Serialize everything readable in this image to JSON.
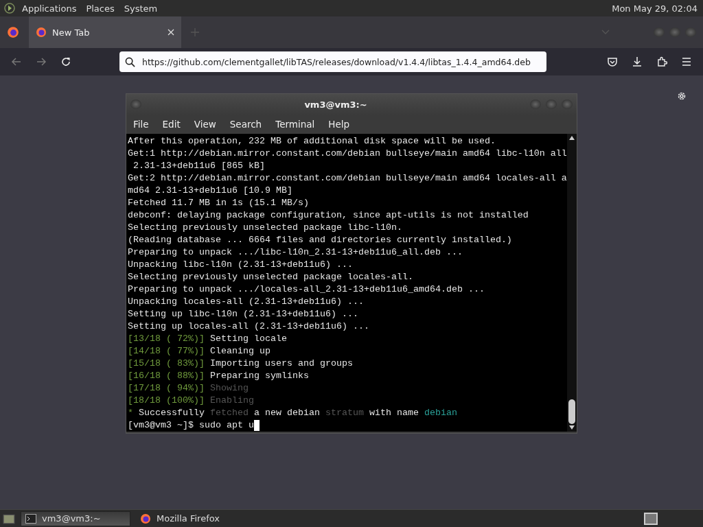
{
  "top_panel": {
    "menus": [
      "Applications",
      "Places",
      "System"
    ],
    "clock": "Mon May 29, 02:04"
  },
  "browser": {
    "tabs": [
      {
        "label": "New Tab",
        "selected": true
      }
    ],
    "url": "https://github.com/clementgallet/libTAS/releases/download/v1.4.4/libtas_1.4.4_amd64.deb"
  },
  "terminal": {
    "title": "vm3@vm3:~",
    "menu": [
      "File",
      "Edit",
      "View",
      "Search",
      "Terminal",
      "Help"
    ],
    "lines": [
      [
        {
          "kind": "plain",
          "text": "After this operation, 232 MB of additional disk space will be used."
        }
      ],
      [
        {
          "kind": "plain",
          "text": "Get:1 http://debian.mirror.constant.com/debian bullseye/main amd64 libc-l10n all"
        }
      ],
      [
        {
          "kind": "plain",
          "text": " 2.31-13+deb11u6 [865 kB]"
        }
      ],
      [
        {
          "kind": "plain",
          "text": "Get:2 http://debian.mirror.constant.com/debian bullseye/main amd64 locales-all a"
        }
      ],
      [
        {
          "kind": "plain",
          "text": "md64 2.31-13+deb11u6 [10.9 MB]"
        }
      ],
      [
        {
          "kind": "plain",
          "text": "Fetched 11.7 MB in 1s (15.1 MB/s)"
        }
      ],
      [
        {
          "kind": "plain",
          "text": "debconf: delaying package configuration, since apt-utils is not installed"
        }
      ],
      [
        {
          "kind": "plain",
          "text": "Selecting previously unselected package libc-l10n."
        }
      ],
      [
        {
          "kind": "plain",
          "text": "(Reading database ... 6664 files and directories currently installed.)"
        }
      ],
      [
        {
          "kind": "plain",
          "text": "Preparing to unpack .../libc-l10n_2.31-13+deb11u6_all.deb ..."
        }
      ],
      [
        {
          "kind": "plain",
          "text": "Unpacking libc-l10n (2.31-13+deb11u6) ..."
        }
      ],
      [
        {
          "kind": "plain",
          "text": "Selecting previously unselected package locales-all."
        }
      ],
      [
        {
          "kind": "plain",
          "text": "Preparing to unpack .../locales-all_2.31-13+deb11u6_amd64.deb ..."
        }
      ],
      [
        {
          "kind": "plain",
          "text": "Unpacking locales-all (2.31-13+deb11u6) ..."
        }
      ],
      [
        {
          "kind": "plain",
          "text": "Setting up libc-l10n (2.31-13+deb11u6) ..."
        }
      ],
      [
        {
          "kind": "plain",
          "text": "Setting up locales-all (2.31-13+deb11u6) ..."
        }
      ],
      [
        {
          "kind": "progress",
          "text": "[13/18 ( 72%)]"
        },
        {
          "kind": "plain",
          "text": " Setting locale"
        }
      ],
      [
        {
          "kind": "progress",
          "text": "[14/18 ( 77%)]"
        },
        {
          "kind": "plain",
          "text": " Cleaning up"
        }
      ],
      [
        {
          "kind": "progress",
          "text": "[15/18 ( 83%)]"
        },
        {
          "kind": "plain",
          "text": " Importing users and groups"
        }
      ],
      [
        {
          "kind": "progress",
          "text": "[16/18 ( 88%)]"
        },
        {
          "kind": "plain",
          "text": " Preparing symlinks"
        }
      ],
      [
        {
          "kind": "progress",
          "text": "[17/18 ( 94%)]"
        },
        {
          "kind": "dim",
          "text": " Showing"
        }
      ],
      [
        {
          "kind": "progress",
          "text": "[18/18 (100%)]"
        },
        {
          "kind": "dim",
          "text": " Enabling"
        }
      ],
      [
        {
          "kind": "progress",
          "text": "*"
        },
        {
          "kind": "plain",
          "text": " Successfully "
        },
        {
          "kind": "dim",
          "text": "fetched"
        },
        {
          "kind": "plain",
          "text": " a new debian "
        },
        {
          "kind": "dim",
          "text": "stratum"
        },
        {
          "kind": "plain",
          "text": " with name "
        },
        {
          "kind": "accent",
          "text": "debian"
        }
      ],
      [
        {
          "kind": "plain",
          "text": "[vm3@vm3 ~]$ sudo apt u"
        }
      ]
    ]
  },
  "taskbar": {
    "tasks": [
      {
        "kind": "terminal",
        "label": "vm3@vm3:~",
        "selected": true
      },
      {
        "kind": "firefox",
        "label": "Mozilla Firefox",
        "selected": false
      }
    ]
  }
}
